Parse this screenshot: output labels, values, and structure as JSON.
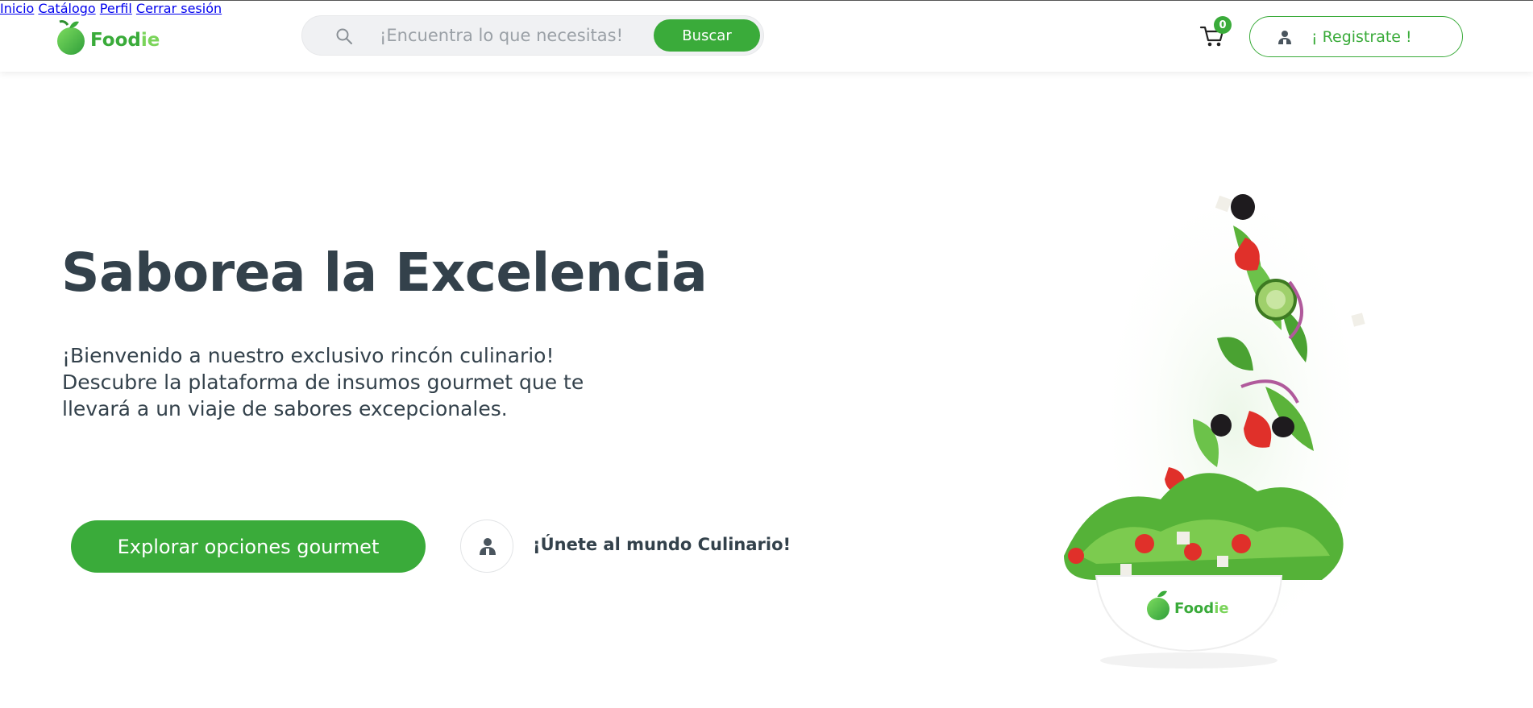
{
  "brand": {
    "name_prefix": "Food",
    "name_suffix": "ie",
    "green": "#3aab3a",
    "light_green": "#6ad45a",
    "dark_text": "#33414b"
  },
  "search": {
    "placeholder": "¡Encuentra lo que necesitas!",
    "button_label": "Buscar",
    "icon": "search-icon"
  },
  "nav": {
    "items": [
      "Inicio",
      "Catálogo",
      "Perfil",
      "Cerrar sesión"
    ]
  },
  "cart": {
    "icon": "cart-icon",
    "count": "0"
  },
  "register": {
    "label": "¡ Registrate !",
    "icon": "user-icon"
  },
  "hero": {
    "title": "Saborea la Excelencia",
    "text_lines": [
      "¡Bienvenido a nuestro exclusivo rincón culinario!",
      "Descubre la plataforma de insumos gourmet que te",
      "llevará a un viaje de sabores excepcionales."
    ],
    "cta_label": "Explorar opciones gourmet",
    "join_label": "¡Únete al mundo Culinario!",
    "join_icon": "user-icon"
  },
  "bowl": {
    "brand_prefix": "Food",
    "brand_suffix": "ie"
  }
}
